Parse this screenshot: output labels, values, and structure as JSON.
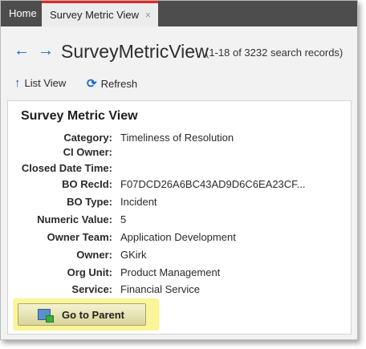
{
  "tabs": {
    "home_label": "Home",
    "active_label": "Survey Metric View",
    "close_glyph": "×"
  },
  "header": {
    "back_glyph": "←",
    "forward_glyph": "→",
    "title": "SurveyMetricView",
    "record_count": "(1-18 of 3232 search records)"
  },
  "toolbar": {
    "list_view_label": "List View",
    "refresh_label": "Refresh"
  },
  "panel": {
    "title": "Survey Metric View",
    "fields": [
      {
        "label": "Category:",
        "value": "Timeliness of Resolution"
      },
      {
        "label": "CI Owner:",
        "value": ""
      },
      {
        "label": "Closed Date Time:",
        "value": ""
      },
      {
        "label": "BO RecId:",
        "value": "F07DCD26A6BC43AD9D6C6EA23CF..."
      },
      {
        "label": "BO Type:",
        "value": "Incident"
      },
      {
        "label": "Numeric Value:",
        "value": "5"
      },
      {
        "label": "Owner Team:",
        "value": "Application Development"
      },
      {
        "label": "Owner:",
        "value": "GKirk"
      },
      {
        "label": "Org Unit:",
        "value": "Product Management"
      },
      {
        "label": "Service:",
        "value": "Financial Service"
      }
    ],
    "go_to_parent_label": "Go to Parent"
  },
  "colors": {
    "accent": "#1a66c4",
    "tab_indicator": "#e32626",
    "highlight": "#fbf59a"
  }
}
